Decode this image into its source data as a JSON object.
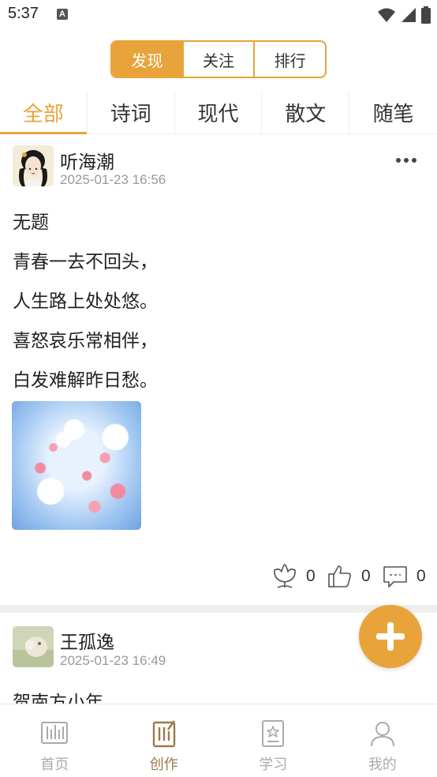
{
  "status_bar": {
    "time": "5:37",
    "notification_letter": "A"
  },
  "segmented": {
    "items": [
      "发现",
      "关注",
      "排行"
    ],
    "active_index": 0
  },
  "category_tabs": {
    "items": [
      "全部",
      "诗词",
      "现代",
      "散文",
      "随笔"
    ],
    "active_index": 0
  },
  "posts": [
    {
      "author": "听海潮",
      "date": "2025-01-23 16:56",
      "lines": [
        "无题",
        "青春一去不回头，",
        "人生路上处处悠。",
        "喜怒哀乐常相伴，",
        "白发难解昨日愁。"
      ],
      "flower_count": "0",
      "like_count": "0",
      "comment_count": "0"
    },
    {
      "author": "王孤逸",
      "date": "2025-01-23 16:49",
      "lines": [
        "贺南方小年"
      ]
    }
  ],
  "bottom_nav": {
    "items": [
      {
        "label": "首页",
        "icon": "home-icon"
      },
      {
        "label": "创作",
        "icon": "create-icon"
      },
      {
        "label": "学习",
        "icon": "study-icon"
      },
      {
        "label": "我的",
        "icon": "profile-icon"
      }
    ],
    "active_index": 1
  },
  "colors": {
    "accent": "#e8a43a",
    "nav_active": "#9a7a4a",
    "nav_inactive": "#aaaaaa"
  }
}
